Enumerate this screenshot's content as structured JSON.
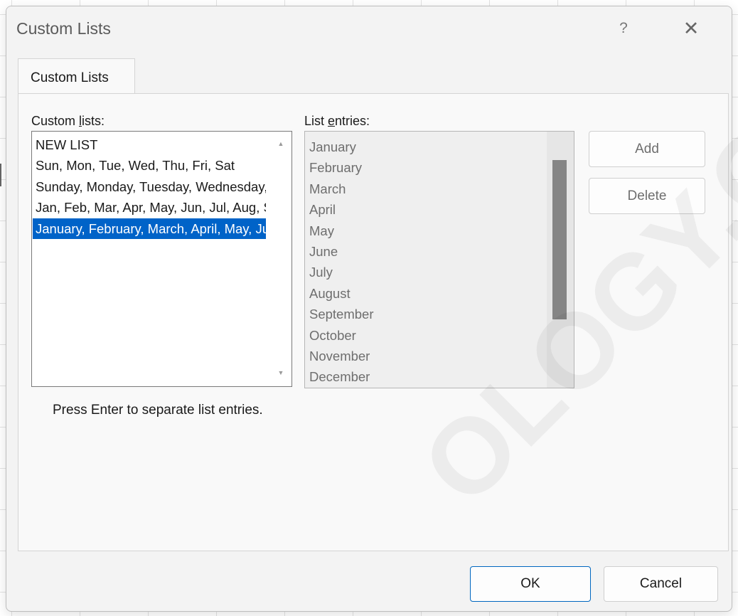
{
  "window": {
    "title": "Custom Lists",
    "help_glyph": "?",
    "close_glyph": "✕"
  },
  "tabs": [
    {
      "label": "Custom Lists",
      "active": true
    }
  ],
  "custom_lists": {
    "label_before": "Custom ",
    "label_accel": "l",
    "label_after": "ists:",
    "items": [
      {
        "text": "NEW LIST",
        "selected": false
      },
      {
        "text": "Sun, Mon, Tue, Wed, Thu, Fri, Sat",
        "selected": false
      },
      {
        "text": "Sunday, Monday, Tuesday, Wednesday, Thursday, Friday, Saturday",
        "selected": false
      },
      {
        "text": "Jan, Feb, Mar, Apr, May, Jun, Jul, Aug, Sep, Oct, Nov, Dec",
        "selected": false
      },
      {
        "text": "January, February, March, April, May, June, July, August, September, October, November, December",
        "selected": true
      }
    ],
    "scroll_up_icon": "▲",
    "scroll_down_icon": "▼"
  },
  "list_entries": {
    "label_before": "List ",
    "label_accel": "e",
    "label_after": "ntries:",
    "items": [
      "January",
      "February",
      "March",
      "April",
      "May",
      "June",
      "July",
      "August",
      "September",
      "October",
      "November",
      "December"
    ],
    "scroll_thumb_fraction": 0.62
  },
  "buttons": {
    "add": "Add",
    "delete": "Delete",
    "ok": "OK",
    "cancel": "Cancel"
  },
  "hint": "Press Enter to separate list entries.",
  "watermark": "OLOGY.CO",
  "colors": {
    "selection": "#0063c8",
    "primary_border": "#0067c0"
  }
}
